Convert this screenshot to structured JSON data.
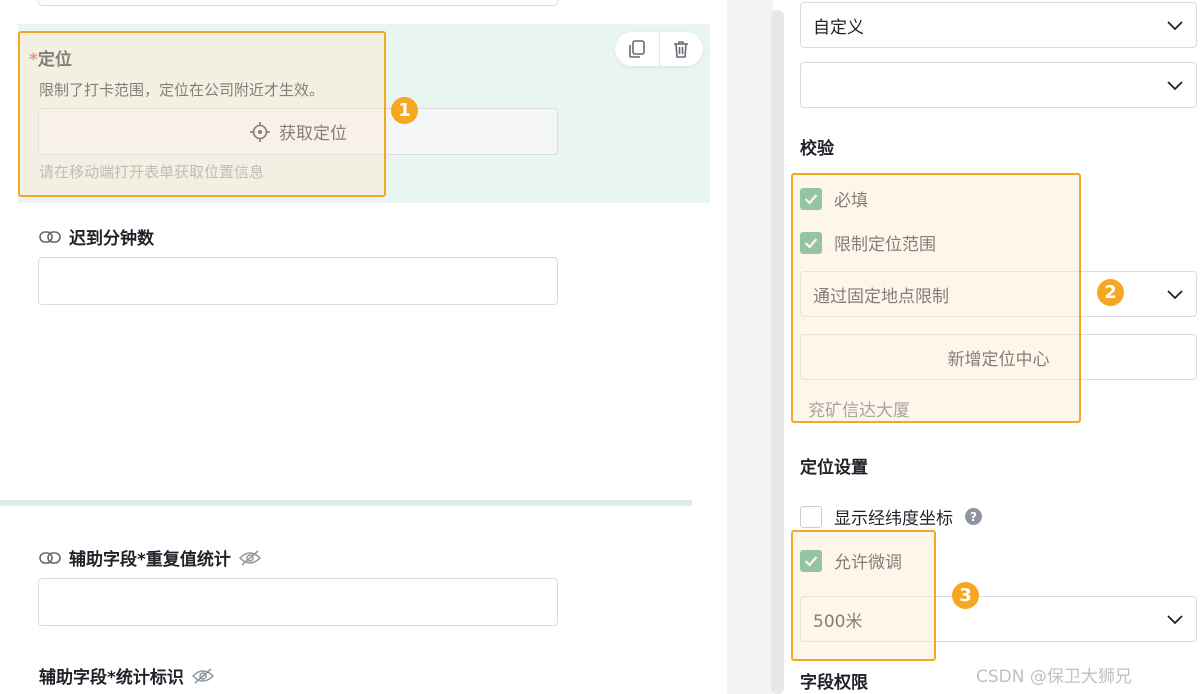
{
  "location_field": {
    "required_mark": "*",
    "label": "定位",
    "description": "限制了打卡范围，定位在公司附近才生效。",
    "get_location_label": "获取定位",
    "hint": "请在移动端打开表单获取位置信息"
  },
  "late_minutes_field": {
    "label": "迟到分钟数"
  },
  "aux_repeat_field": {
    "label": "辅助字段*重复值统计"
  },
  "aux_stat_field": {
    "label": "辅助字段*统计标识"
  },
  "annotations": {
    "badge1": "1",
    "badge2": "2",
    "badge3": "3"
  },
  "settings": {
    "default_select": "自定义",
    "second_select": "",
    "validation_title": "校验",
    "required_label": "必填",
    "required_checked": true,
    "limit_range_label": "限制定位范围",
    "limit_range_checked": true,
    "limit_mode_select": "通过固定地点限制",
    "add_center_button": "新增定位中心",
    "center_address": "兖矿信达大厦",
    "location_settings_title": "定位设置",
    "show_coords_label": "显示经纬度坐标",
    "show_coords_checked": false,
    "allow_adjust_label": "允许微调",
    "allow_adjust_checked": true,
    "adjust_range_select": "500米",
    "field_permission_title": "字段权限"
  },
  "watermark": "CSDN @保卫大狮兄",
  "colors": {
    "accent_green": "#3fa57f",
    "annotation_orange": "#f5a623",
    "selected_bg": "#e9f5f1"
  }
}
